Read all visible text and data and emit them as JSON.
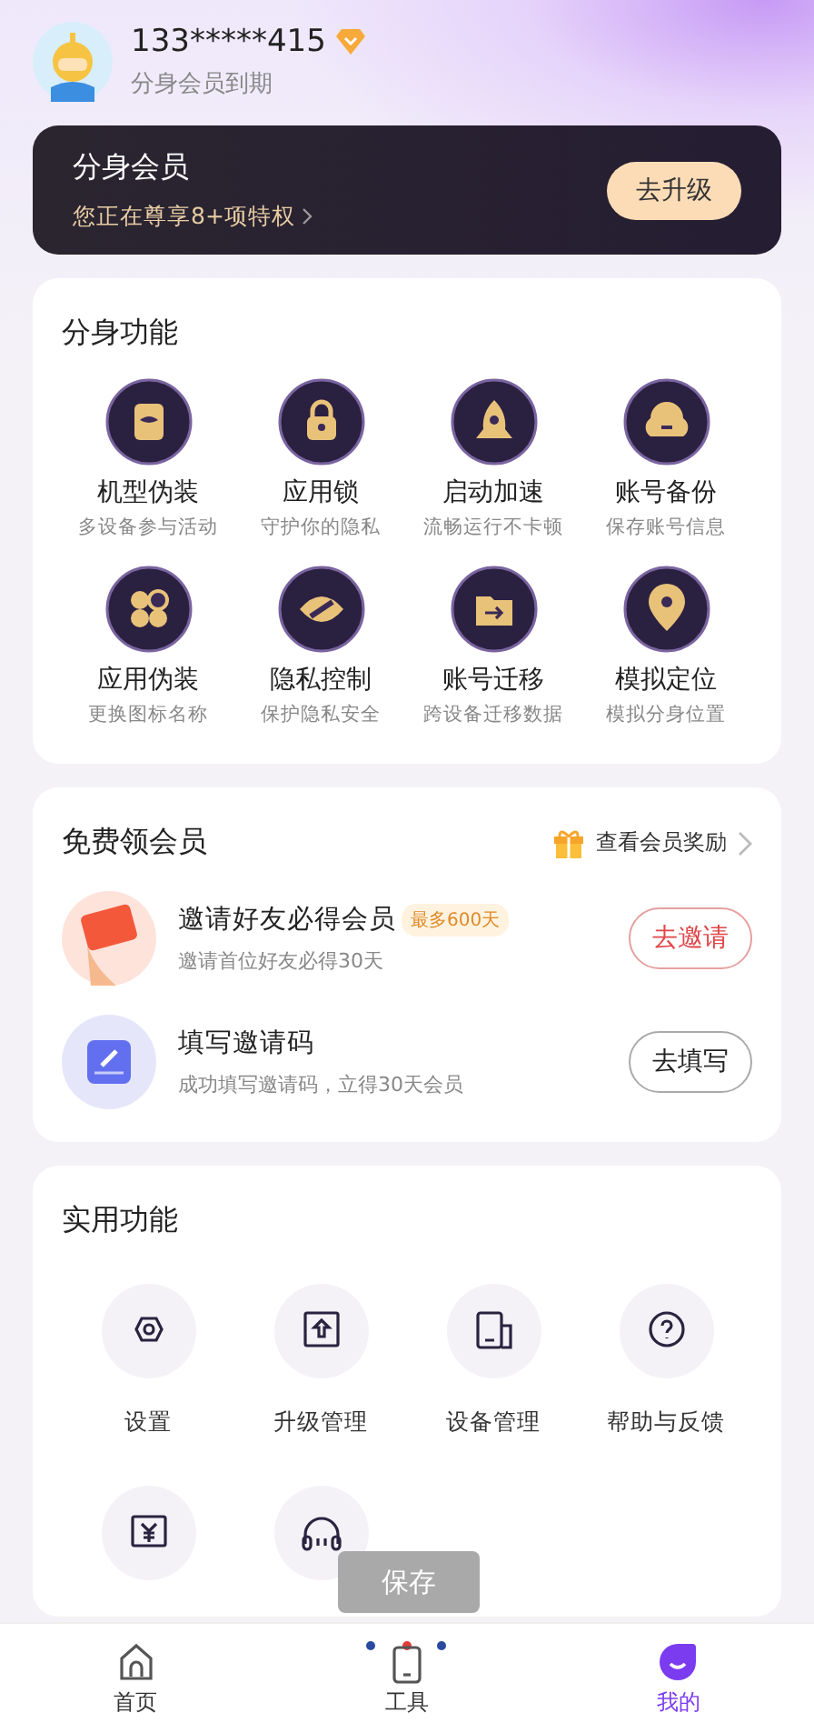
{
  "profile": {
    "phone": "133*****415",
    "status": "分身会员到期",
    "vip_badge": true
  },
  "member_card": {
    "title": "分身会员",
    "subtitle": "您正在尊享8+项特权",
    "button": "去升级"
  },
  "features": {
    "title": "分身功能",
    "items": [
      {
        "name": "机型伪装",
        "desc": "多设备参与活动"
      },
      {
        "name": "应用锁",
        "desc": "守护你的隐私"
      },
      {
        "name": "启动加速",
        "desc": "流畅运行不卡顿"
      },
      {
        "name": "账号备份",
        "desc": "保存账号信息"
      },
      {
        "name": "应用伪装",
        "desc": "更换图标名称"
      },
      {
        "name": "隐私控制",
        "desc": "保护隐私安全"
      },
      {
        "name": "账号迁移",
        "desc": "跨设备迁移数据"
      },
      {
        "name": "模拟定位",
        "desc": "模拟分身位置"
      }
    ]
  },
  "free_member": {
    "title": "免费领会员",
    "link": "查看会员奖励",
    "tasks": [
      {
        "kind": "invite",
        "title": "邀请好友必得会员",
        "tag": "最多600天",
        "desc": "邀请首位好友必得30天",
        "button": "去邀请"
      },
      {
        "kind": "code",
        "title": "填写邀请码",
        "desc": "成功填写邀请码，立得30天会员",
        "button": "去填写"
      }
    ]
  },
  "tools": {
    "title": "实用功能",
    "items": [
      {
        "kind": "labeled",
        "label": "设置"
      },
      {
        "kind": "labeled",
        "label": "升级管理"
      },
      {
        "kind": "labeled",
        "label": "设备管理"
      },
      {
        "kind": "labeled",
        "label": "帮助与反馈"
      },
      {
        "kind": "cut_off"
      },
      {
        "kind": "cut_off"
      }
    ]
  },
  "toast": "保存",
  "tab_bar": [
    {
      "label": "首页",
      "selected": false
    },
    {
      "label": "工具",
      "selected": false
    },
    {
      "label": "我的",
      "selected": true
    }
  ]
}
